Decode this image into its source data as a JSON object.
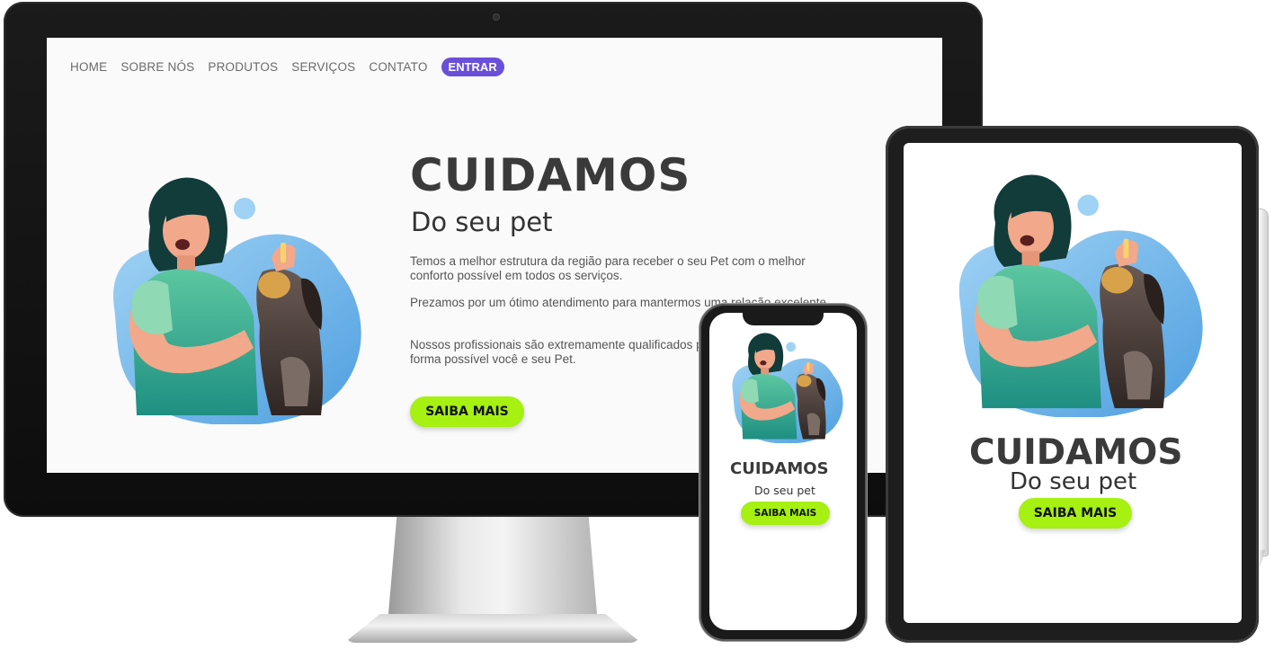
{
  "nav": {
    "items": [
      "HOME",
      "SOBRE NÓS",
      "PRODUTOS",
      "SERVIÇOS",
      "CONTATO"
    ],
    "login": "ENTRAR"
  },
  "hero": {
    "title": "CUIDAMOS",
    "subtitle": "Do seu pet",
    "paragraphs": [
      "Temos a melhor estrutura da região para receber o seu Pet com o melhor conforto possível em todos os serviços.",
      "Prezamos por um ótimo atendimento para mantermos uma relação excelente.",
      "Nossos profissionais são extremamente qualificados para atender da melhor forma possível você e seu Pet."
    ],
    "cta": "SAIBA MAIS"
  },
  "colors": {
    "accent": "#6a4fd8",
    "cta": "#a6f012",
    "illustration_blue": "#6cb6ea",
    "shirt_green": "#3fb08a"
  },
  "icons": [
    "woman-with-dog-illustration"
  ]
}
